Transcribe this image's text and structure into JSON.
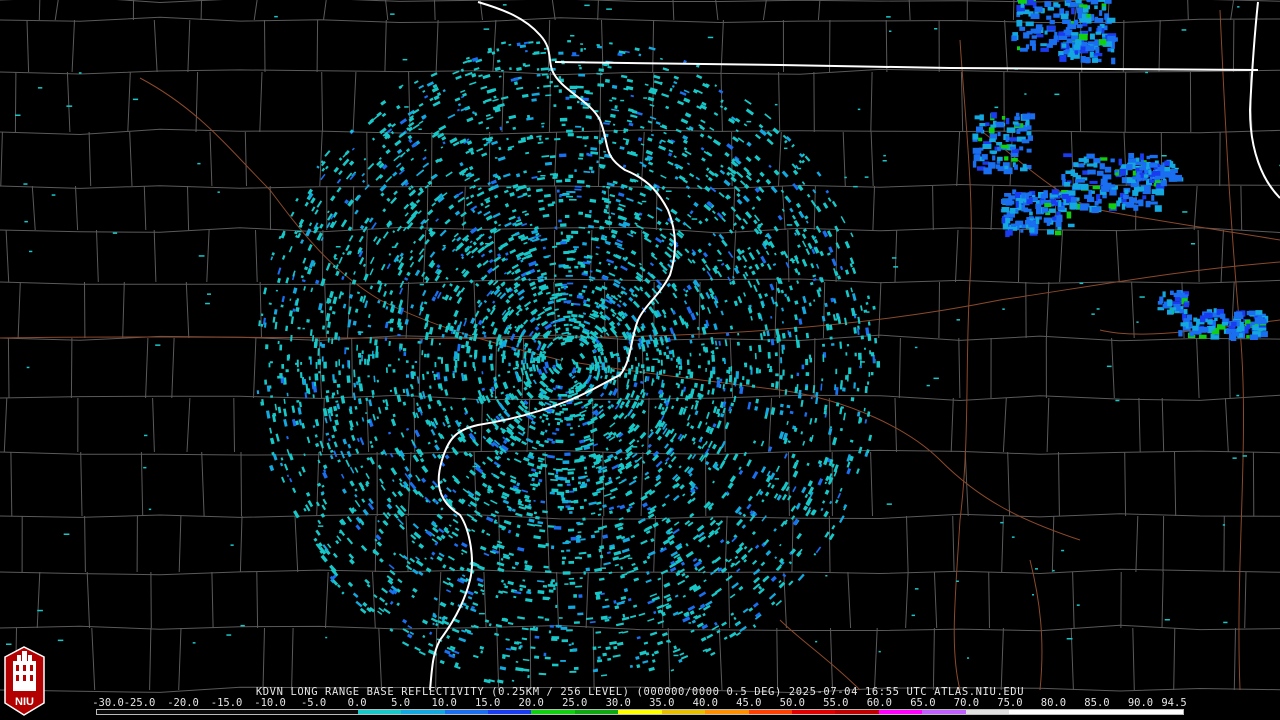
{
  "radar": {
    "caption": "KDVN LONG RANGE BASE REFLECTIVITY (0.25KM / 256 LEVEL) (000000/0000 0.5 DEG) 2025-07-04 16:55 UTC  ATLAS.NIU.EDU"
  },
  "scale": {
    "labels": [
      "-30.0",
      "-25.0",
      "-20.0",
      "-15.0",
      "-10.0",
      "-5.0",
      "0.0",
      "5.0",
      "10.0",
      "15.0",
      "20.0",
      "25.0",
      "30.0",
      "35.0",
      "40.0",
      "45.0",
      "50.0",
      "55.0",
      "60.0",
      "65.0",
      "70.0",
      "75.0",
      "80.0",
      "85.0",
      "90.0",
      "94.5"
    ],
    "colors": [
      "#0a0a0a",
      "#0a0a0a",
      "#0a0a0a",
      "#0a0a0a",
      "#0a0a0a",
      "#0a0a0a",
      "#18c8c8",
      "#14a8e0",
      "#1a6ff0",
      "#1a3cf0",
      "#10d010",
      "#10a810",
      "#ffff00",
      "#e8c000",
      "#ff9000",
      "#ff4000",
      "#e00000",
      "#c00000",
      "#ff00ff",
      "#c060ff",
      "#e0e0e0",
      "#ffffff",
      "#ffffff",
      "#ffffff",
      "#ffffff"
    ]
  },
  "logo": {
    "text": "NIU"
  },
  "colors": {
    "background": "#000000",
    "county_lines": "#5a5a5a",
    "state_lines": "#ffffff",
    "highways": "#8b4a2b",
    "radar_light": "#18c8c8",
    "radar_mid": "#1a6ff0",
    "radar_strong": "#10d010"
  }
}
